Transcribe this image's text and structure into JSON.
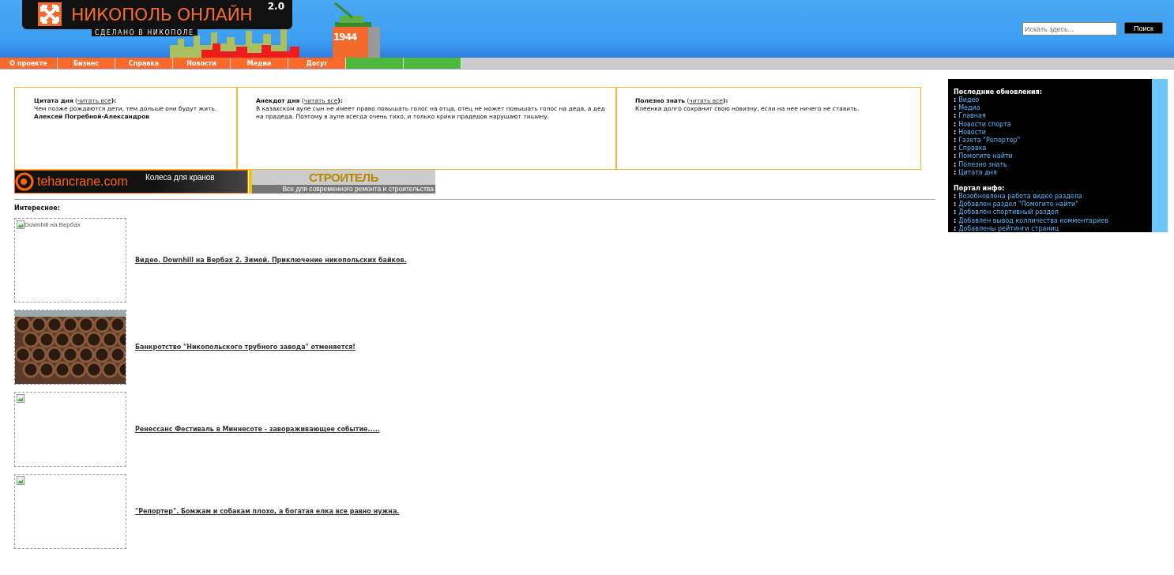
{
  "header": {
    "logo_title": "НИКОПОЛЬ ОНЛАЙН",
    "logo_version": "2.0",
    "logo_slogan": "СДЕЛАНО В НИКОПОЛЕ",
    "monument_year": "1944",
    "search": {
      "placeholder": "Искать здесь..."
    },
    "search_button": "Поиск"
  },
  "nav": [
    {
      "label": "О проекте",
      "color": "#ff6a2a"
    },
    {
      "label": "Бизнес",
      "color": "#ff6a2a"
    },
    {
      "label": "Справка",
      "color": "#ff6a2a"
    },
    {
      "label": "Новости",
      "color": "#ff6a2a"
    },
    {
      "label": "Медиа",
      "color": "#ff6a2a"
    },
    {
      "label": "Досуг",
      "color": "#ff6a2a"
    },
    {
      "color": "#4cb93a"
    },
    {
      "color": "#4cb93a"
    }
  ],
  "link_brackets": [
    "(",
    "):"
  ],
  "info_boxes": [
    {
      "title": "Цитата дня",
      "link": "читать все",
      "text": "Чем позже рождаются дети, тем дольше они будут жить.",
      "author": "Алексей Погребной-Александров"
    },
    {
      "title": "Анекдот дня",
      "link": "читать все",
      "text": "В казахском ауле сын не имеет право повышать голос на отца, отец не может повышать голос на деда, а дед на прадеда. Поэтому в ауле всегда очень тихо, и только крики прадедов нарушают тишину."
    },
    {
      "title": "Полезно знать",
      "link": "читать все",
      "text": "Клеенка долго сохранит свою новизну, если на нее ничего не ставить."
    }
  ],
  "banners": [
    {
      "kind": "crane",
      "brand": "tehancrane.com",
      "tagline": "Колеса для кранов"
    },
    {
      "kind": "builder",
      "brand": "СТРОИТЕЛЬ",
      "tagline": "Все для современного ремонта и строительства"
    }
  ],
  "interesting": {
    "heading": "Интересное:",
    "items": [
      {
        "image": {
          "kind": "broken",
          "alt": "Downhill на Вербах"
        },
        "title": " Видео. Downhill на Вербах 2. Зимой. Приключение никопольских байков."
      },
      {
        "title": "Банкротство \"Никопольского трубного завода\" отменяется!"
      },
      {
        "image": {
          "kind": "broken"
        },
        "title": "Ренессанс Фестиваль в Миннесоте - завораживающее событие....."
      },
      {
        "image": {
          "kind": "broken"
        },
        "title": "\"Репортер\". Бомжам и собакам плохо, а богатая елка все равно нужна."
      }
    ]
  },
  "sidebar": {
    "sections": [
      {
        "heading": "Последние обновления:",
        "links": [
          "Видео",
          "Медиа",
          "Главная",
          "Новости спорта",
          "Новости",
          "Газета \"Репортер\"",
          "Справка",
          "Помогите найти",
          "Полезно знать",
          "Цитата дня"
        ]
      },
      {
        "heading": "Портал инфо:",
        "links": [
          "Возобновлена работа видео раздела",
          "Добавлен раздел \"Помогите найти\"",
          "Добавлен спортивный раздел",
          "Добавлен вывод колличества комментариев",
          "Добавлены рейтинги страниц"
        ]
      }
    ],
    "bullet": ":"
  }
}
